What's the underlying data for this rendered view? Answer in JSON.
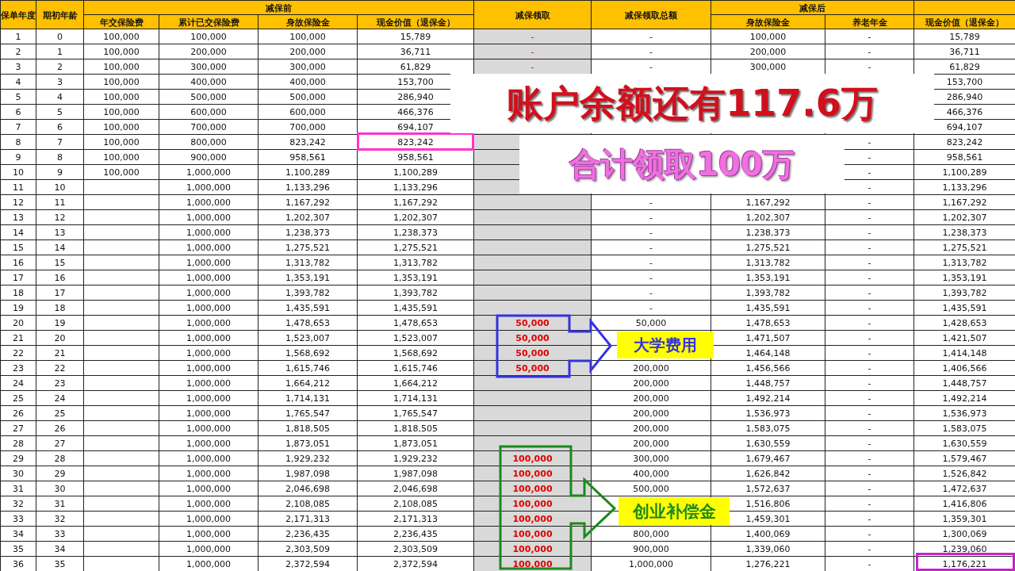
{
  "column_groups": [
    {
      "label": "保单年度"
    },
    {
      "label": "期初年龄"
    },
    {
      "label": "减保前",
      "columns": [
        "年交保险费",
        "累计已交保险费",
        "身故保险金",
        "现金价值（退保金）"
      ]
    },
    {
      "label": "减保领取"
    },
    {
      "label": "减保领取总额"
    },
    {
      "label": "减保后",
      "columns": [
        "身故保险金",
        "养老年金"
      ]
    },
    {
      "columns": [
        "现金价值（退保金）"
      ]
    }
  ],
  "rows": [
    [
      "1",
      "0",
      "100,000",
      "100,000",
      "100,000",
      "15,789",
      "-",
      "-",
      "100,000",
      "-",
      "15,789"
    ],
    [
      "2",
      "1",
      "100,000",
      "200,000",
      "200,000",
      "36,711",
      "-",
      "-",
      "200,000",
      "-",
      "36,711"
    ],
    [
      "3",
      "2",
      "100,000",
      "300,000",
      "300,000",
      "61,829",
      "-",
      "-",
      "300,000",
      "-",
      "61,829"
    ],
    [
      "4",
      "3",
      "100,000",
      "400,000",
      "400,000",
      "153,700",
      null,
      null,
      null,
      null,
      "153,700"
    ],
    [
      "5",
      "4",
      "100,000",
      "500,000",
      "500,000",
      "286,940",
      null,
      null,
      null,
      null,
      "286,940"
    ],
    [
      "6",
      "5",
      "100,000",
      "600,000",
      "600,000",
      "466,376",
      null,
      null,
      null,
      null,
      "466,376"
    ],
    [
      "7",
      "6",
      "100,000",
      "700,000",
      "700,000",
      "694,107",
      null,
      null,
      null,
      null,
      "694,107"
    ],
    [
      "8",
      "7",
      "100,000",
      "800,000",
      "823,242",
      "823,242",
      null,
      null,
      null,
      "-",
      "823,242"
    ],
    [
      "9",
      "8",
      "100,000",
      "900,000",
      "958,561",
      "958,561",
      null,
      null,
      null,
      "-",
      "958,561"
    ],
    [
      "10",
      "9",
      "100,000",
      "1,000,000",
      "1,100,289",
      "1,100,289",
      null,
      null,
      null,
      "-",
      "1,100,289"
    ],
    [
      "11",
      "10",
      null,
      "1,000,000",
      "1,133,296",
      "1,133,296",
      null,
      null,
      null,
      "-",
      "1,133,296"
    ],
    [
      "12",
      "11",
      null,
      "1,000,000",
      "1,167,292",
      "1,167,292",
      null,
      "-",
      "1,167,292",
      "-",
      "1,167,292"
    ],
    [
      "13",
      "12",
      null,
      "1,000,000",
      "1,202,307",
      "1,202,307",
      null,
      "-",
      "1,202,307",
      "-",
      "1,202,307"
    ],
    [
      "14",
      "13",
      null,
      "1,000,000",
      "1,238,373",
      "1,238,373",
      null,
      "-",
      "1,238,373",
      "-",
      "1,238,373"
    ],
    [
      "15",
      "14",
      null,
      "1,000,000",
      "1,275,521",
      "1,275,521",
      null,
      "-",
      "1,275,521",
      "-",
      "1,275,521"
    ],
    [
      "16",
      "15",
      null,
      "1,000,000",
      "1,313,782",
      "1,313,782",
      null,
      "-",
      "1,313,782",
      "-",
      "1,313,782"
    ],
    [
      "17",
      "16",
      null,
      "1,000,000",
      "1,353,191",
      "1,353,191",
      null,
      "-",
      "1,353,191",
      "-",
      "1,353,191"
    ],
    [
      "18",
      "17",
      null,
      "1,000,000",
      "1,393,782",
      "1,393,782",
      null,
      "-",
      "1,393,782",
      "-",
      "1,393,782"
    ],
    [
      "19",
      "18",
      null,
      "1,000,000",
      "1,435,591",
      "1,435,591",
      null,
      "-",
      "1,435,591",
      "-",
      "1,435,591"
    ],
    [
      "20",
      "19",
      null,
      "1,000,000",
      "1,478,653",
      "1,478,653",
      "50,000",
      "50,000",
      "1,478,653",
      "-",
      "1,428,653"
    ],
    [
      "21",
      "20",
      null,
      "1,000,000",
      "1,523,007",
      "1,523,007",
      "50,000",
      null,
      "1,471,507",
      "-",
      "1,421,507"
    ],
    [
      "22",
      "21",
      null,
      "1,000,000",
      "1,568,692",
      "1,568,692",
      "50,000",
      null,
      "1,464,148",
      "-",
      "1,414,148"
    ],
    [
      "23",
      "22",
      null,
      "1,000,000",
      "1,615,746",
      "1,615,746",
      "50,000",
      "200,000",
      "1,456,566",
      "-",
      "1,406,566"
    ],
    [
      "24",
      "23",
      null,
      "1,000,000",
      "1,664,212",
      "1,664,212",
      null,
      "200,000",
      "1,448,757",
      "-",
      "1,448,757"
    ],
    [
      "25",
      "24",
      null,
      "1,000,000",
      "1,714,131",
      "1,714,131",
      null,
      "200,000",
      "1,492,214",
      "-",
      "1,492,214"
    ],
    [
      "26",
      "25",
      null,
      "1,000,000",
      "1,765,547",
      "1,765,547",
      null,
      "200,000",
      "1,536,973",
      "-",
      "1,536,973"
    ],
    [
      "27",
      "26",
      null,
      "1,000,000",
      "1,818,505",
      "1,818,505",
      null,
      "200,000",
      "1,583,075",
      "-",
      "1,583,075"
    ],
    [
      "28",
      "27",
      null,
      "1,000,000",
      "1,873,051",
      "1,873,051",
      null,
      "200,000",
      "1,630,559",
      "-",
      "1,630,559"
    ],
    [
      "29",
      "28",
      null,
      "1,000,000",
      "1,929,232",
      "1,929,232",
      "100,000",
      "300,000",
      "1,679,467",
      "-",
      "1,579,467"
    ],
    [
      "30",
      "29",
      null,
      "1,000,000",
      "1,987,098",
      "1,987,098",
      "100,000",
      "400,000",
      "1,626,842",
      "-",
      "1,526,842"
    ],
    [
      "31",
      "30",
      null,
      "1,000,000",
      "2,046,698",
      "2,046,698",
      "100,000",
      "500,000",
      "1,572,637",
      "-",
      "1,472,637"
    ],
    [
      "32",
      "31",
      null,
      "1,000,000",
      "2,108,085",
      "2,108,085",
      "100,000",
      null,
      "1,516,806",
      "-",
      "1,416,806"
    ],
    [
      "33",
      "32",
      null,
      "1,000,000",
      "2,171,313",
      "2,171,313",
      "100,000",
      null,
      "1,459,301",
      "-",
      "1,359,301"
    ],
    [
      "34",
      "33",
      null,
      "1,000,000",
      "2,236,435",
      "2,236,435",
      "100,000",
      "800,000",
      "1,400,069",
      "-",
      "1,300,069"
    ],
    [
      "35",
      "34",
      null,
      "1,000,000",
      "2,303,509",
      "2,303,509",
      "100,000",
      "900,000",
      "1,339,060",
      "-",
      "1,239,060"
    ],
    [
      "36",
      "35",
      null,
      "1,000,000",
      "2,372,594",
      "2,372,594",
      "100,000",
      "1,000,000",
      "1,276,221",
      "-",
      "1,176,221"
    ]
  ],
  "banners": [
    {
      "text": "账户余额还有117.6万",
      "color": "#d0101c"
    },
    {
      "text": "合计领取100万",
      "color": "#f070e0"
    }
  ],
  "callouts": [
    {
      "text": "大学费用",
      "color": "#3333dd"
    },
    {
      "text": "创业补偿金",
      "color": "#1a8a1a"
    }
  ]
}
